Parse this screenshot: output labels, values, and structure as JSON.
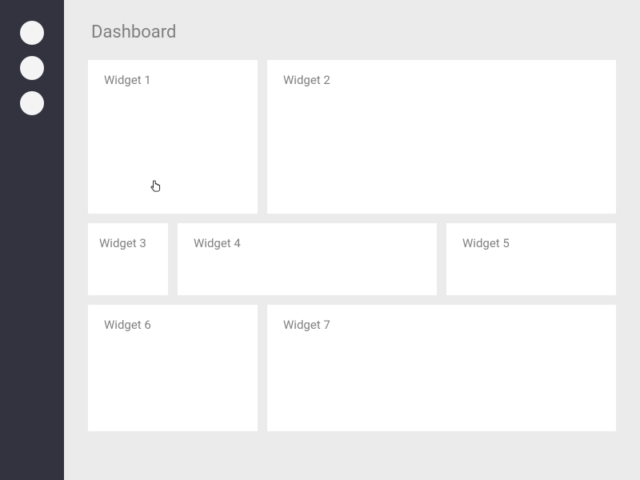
{
  "page": {
    "title": "Dashboard"
  },
  "widgets": [
    {
      "title": "Widget 1"
    },
    {
      "title": "Widget 2"
    },
    {
      "title": "Widget 3"
    },
    {
      "title": "Widget 4"
    },
    {
      "title": "Widget 5"
    },
    {
      "title": "Widget 6"
    },
    {
      "title": "Widget 7"
    }
  ]
}
